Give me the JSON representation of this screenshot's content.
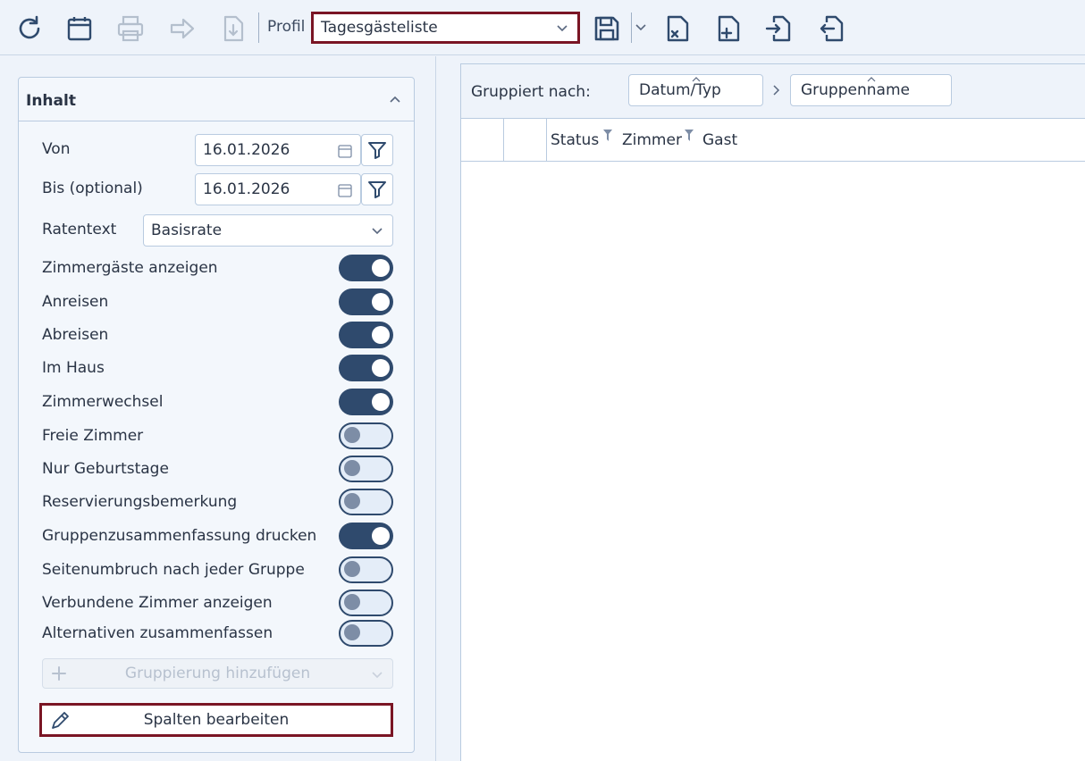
{
  "toolbar": {
    "buttons": [
      {
        "name": "refresh-icon"
      },
      {
        "name": "calendar-icon"
      },
      {
        "name": "print-icon"
      },
      {
        "name": "forward-icon"
      },
      {
        "name": "export-icon"
      },
      {
        "name": "save-icon"
      },
      {
        "name": "delete-profile-icon"
      },
      {
        "name": "new-profile-icon"
      },
      {
        "name": "import-profile-icon"
      },
      {
        "name": "export-profile-icon"
      }
    ],
    "profile_label": "Profil",
    "profile_value": "Tagesgästeliste"
  },
  "content_panel": {
    "title": "Inhalt",
    "from_label": "Von",
    "from_value": "16.01.2026",
    "to_label": "Bis (optional)",
    "to_value": "16.01.2026",
    "rate_label": "Ratentext",
    "rate_value": "Basisrate",
    "toggles": [
      {
        "label": "Zimmergäste anzeigen",
        "on": true
      },
      {
        "label": "Anreisen",
        "on": true
      },
      {
        "label": "Abreisen",
        "on": true
      },
      {
        "label": "Im Haus",
        "on": true
      },
      {
        "label": "Zimmerwechsel",
        "on": true
      },
      {
        "label": "Freie Zimmer",
        "on": false
      },
      {
        "label": "Nur Geburtstage",
        "on": false
      },
      {
        "label": "Reservierungsbemerkung",
        "on": false
      },
      {
        "label": "Gruppenzusammenfassung drucken",
        "on": true
      },
      {
        "label": "Seitenumbruch nach jeder Gruppe",
        "on": false
      },
      {
        "label": "Verbundene Zimmer anzeigen",
        "on": false
      },
      {
        "label": "Alternativen zusammenfassen",
        "on": false
      }
    ],
    "add_grouping_label": "Gruppierung hinzufügen",
    "edit_columns_label": "Spalten bearbeiten"
  },
  "grid": {
    "grouped_by_label": "Gruppiert nach:",
    "groups": [
      "Datum/Typ",
      "Gruppenname"
    ],
    "columns": [
      "Status",
      "Zimmer",
      "Gast"
    ]
  },
  "colors": {
    "accent": "#2f4a6d",
    "highlight_border": "#7a1524",
    "background": "#eef3fa"
  }
}
